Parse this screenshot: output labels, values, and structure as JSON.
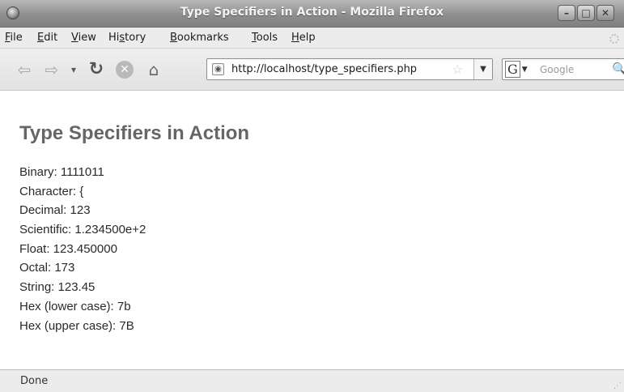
{
  "window": {
    "title": "Type Specifiers in Action - Mozilla Firefox",
    "controls": {
      "minimize": "–",
      "maximize": "□",
      "close": "✕"
    }
  },
  "menu": {
    "items": [
      {
        "key": "file",
        "label": "File",
        "mnemonic": "F"
      },
      {
        "key": "edit",
        "label": "Edit",
        "mnemonic": "E"
      },
      {
        "key": "view",
        "label": "View",
        "mnemonic": "V"
      },
      {
        "key": "history",
        "label": "History",
        "mnemonic": "s"
      },
      {
        "key": "bookmarks",
        "label": "Bookmarks",
        "mnemonic": "B"
      },
      {
        "key": "tools",
        "label": "Tools",
        "mnemonic": "T"
      },
      {
        "key": "help",
        "label": "Help",
        "mnemonic": "H"
      }
    ]
  },
  "toolbar": {
    "icons": {
      "back": "back-arrow-icon",
      "forward": "forward-arrow-icon",
      "history_dropdown": "dropdown-caret-icon",
      "reload": "reload-icon",
      "stop": "stop-icon",
      "home": "home-icon"
    },
    "url": "http://localhost/type_specifiers.php",
    "search": {
      "engine": "G",
      "placeholder": "Google"
    }
  },
  "page": {
    "heading": "Type Specifiers in Action",
    "lines": [
      "Binary: 1111011",
      "Character: {",
      "Decimal: 123",
      "Scientific: 1.234500e+2",
      "Float: 123.450000",
      "Octal: 173",
      "String: 123.45",
      "Hex (lower case): 7b",
      "Hex (upper case): 7B"
    ]
  },
  "status": {
    "text": "Done"
  }
}
